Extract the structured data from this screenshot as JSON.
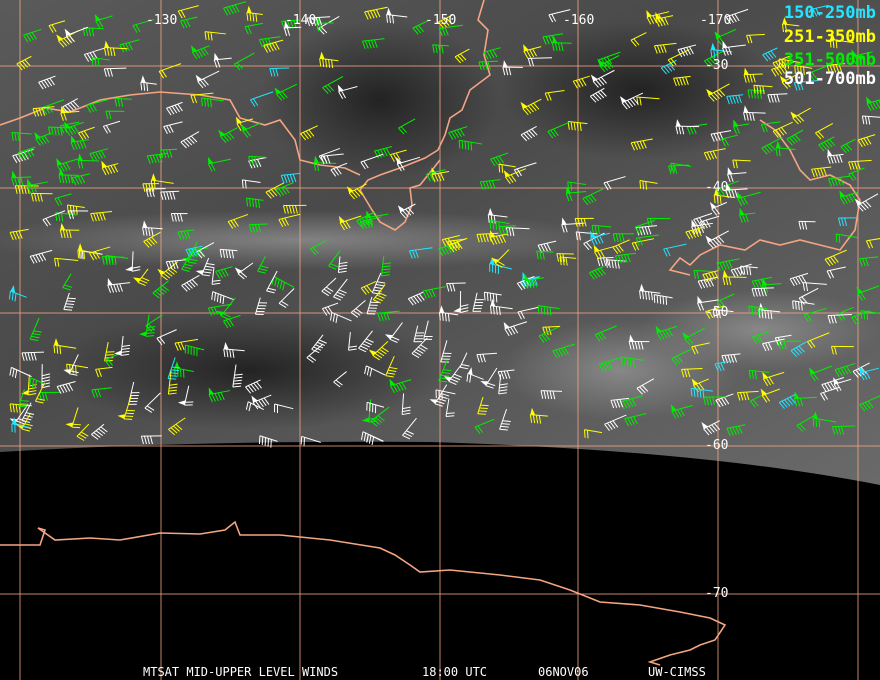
{
  "colors": {
    "level_150_250": "#22e5ff",
    "level_251_350": "#ffff00",
    "level_351_500": "#00ee00",
    "level_501_700": "#ffffff",
    "coastline": "#f4a582",
    "grid": "#f4a582"
  },
  "legend": [
    {
      "label": "150-250mb",
      "color": "#22e5ff"
    },
    {
      "label": "251-350mb",
      "color": "#ffff00"
    },
    {
      "label": "351-500mb",
      "color": "#00ee00"
    },
    {
      "label": "501-700mb",
      "color": "#ffffff"
    }
  ],
  "longitude_labels": [
    "-130",
    "-140",
    "-150",
    "-160",
    "-170"
  ],
  "latitude_labels": [
    "-30",
    "-40",
    "-50",
    "-60",
    "-70"
  ],
  "caption": {
    "product": "MTSAT MID-UPPER LEVEL WINDS",
    "time": "18:00 UTC",
    "date": "06NOV06",
    "source": "UW-CIMSS"
  }
}
